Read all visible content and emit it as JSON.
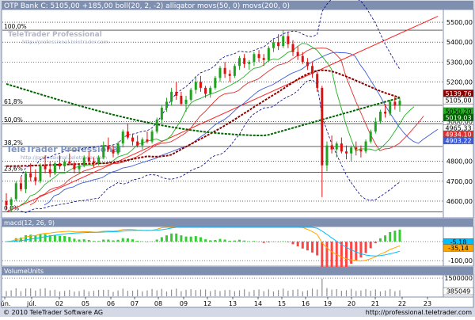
{
  "header": {
    "title": "OTP Bank C: 5105,00 +185,00 boll(20, 2, -2) alligator movs(50, 0) movs(200, 0)"
  },
  "watermark": {
    "brand": "TeleTrader Professional",
    "url": "http://professional.teletrader.com"
  },
  "footer": {
    "copyright": "© 2010 TeleTrader Software AG",
    "url": "http://professional.teletrader.com"
  },
  "colors": {
    "frame": "#7f8fb0",
    "axis_bg": "#ffffff",
    "grid": "#000000",
    "up": "#1fa31f",
    "down": "#e01010",
    "trendline": "#ff2020",
    "boll_band": "#00008b",
    "boll_mid": "#cc3333",
    "alligator_jaw": "#3b5bdb",
    "alligator_teeth": "#e03030",
    "alligator_lips": "#20b020",
    "ma50": "#8b0000",
    "ma200": "#006400",
    "macd_line": "#ffa500",
    "macd_signal": "#00bfff",
    "hist_pos": "#33cc33",
    "hist_neg": "#ff4444",
    "volume": "#909090"
  },
  "chart_data": [
    {
      "type": "candlestick",
      "ylim": [
        4520,
        5560
      ],
      "y_ticks": [
        "5500,00",
        "5400,00",
        "5300,00",
        "5200,00",
        "5000,00",
        "4800,00",
        "4700,00",
        "4600,00"
      ],
      "y_tick_values": [
        5500,
        5400,
        5300,
        5200,
        5000,
        4800,
        4700,
        4600
      ],
      "x_labels": [
        "jún.",
        "júl.",
        "02",
        "05",
        "06",
        "07",
        "08",
        "09",
        "12",
        "13",
        "14",
        "15",
        "16",
        "19",
        "20",
        "21",
        "22",
        "23"
      ],
      "fib_levels": [
        {
          "label": "100,0%",
          "value": 5460
        },
        {
          "label": "61,8%",
          "value": 5082
        },
        {
          "label": "50,0%",
          "value": 4990
        },
        {
          "label": "38,2%",
          "value": 4875
        },
        {
          "label": "23,6%",
          "value": 4745
        },
        {
          "label": "0,0%",
          "value": 4545
        }
      ],
      "price_tags": [
        {
          "label": "5139,76",
          "value": 5139.76,
          "bg": "#8b0000",
          "fg": "#ffffff"
        },
        {
          "label": "5105,00",
          "value": 5105,
          "bg": "#ffffff",
          "fg": "#000000"
        },
        {
          "label": "5050,20",
          "value": 5050.2,
          "bg": "#20b020",
          "fg": "#000000"
        },
        {
          "label": "5019,03",
          "value": 5019.03,
          "bg": "#006400",
          "fg": "#ffffff"
        },
        {
          "label": "4965,33",
          "value": 4965.33,
          "bg": "#ffffff",
          "fg": "#000000"
        },
        {
          "label": "4934,10",
          "value": 4934.1,
          "bg": "#e03030",
          "fg": "#ffffff"
        },
        {
          "label": "4903,22",
          "value": 4903.22,
          "bg": "#3b5bdb",
          "fg": "#ffffff"
        }
      ],
      "candles": [
        [
          4600,
          4640,
          4560,
          4580
        ],
        [
          4580,
          4620,
          4545,
          4610
        ],
        [
          4610,
          4700,
          4600,
          4690
        ],
        [
          4690,
          4720,
          4650,
          4660
        ],
        [
          4660,
          4750,
          4640,
          4740
        ],
        [
          4740,
          4790,
          4700,
          4720
        ],
        [
          4720,
          4760,
          4680,
          4700
        ],
        [
          4700,
          4790,
          4690,
          4780
        ],
        [
          4780,
          4830,
          4740,
          4760
        ],
        [
          4760,
          4800,
          4720,
          4740
        ],
        [
          4740,
          4800,
          4730,
          4790
        ],
        [
          4790,
          4830,
          4760,
          4775
        ],
        [
          4775,
          4810,
          4750,
          4800
        ],
        [
          4800,
          4840,
          4780,
          4790
        ],
        [
          4790,
          4800,
          4740,
          4760
        ],
        [
          4760,
          4790,
          4740,
          4780
        ],
        [
          4780,
          4830,
          4770,
          4820
        ],
        [
          4820,
          4850,
          4790,
          4800
        ],
        [
          4800,
          4820,
          4770,
          4790
        ],
        [
          4790,
          4830,
          4780,
          4820
        ],
        [
          4820,
          4900,
          4810,
          4880
        ],
        [
          4880,
          4920,
          4850,
          4860
        ],
        [
          4860,
          4880,
          4820,
          4840
        ],
        [
          4840,
          4900,
          4830,
          4890
        ],
        [
          4890,
          4960,
          4870,
          4950
        ],
        [
          4950,
          4990,
          4910,
          4920
        ],
        [
          4920,
          4940,
          4880,
          4900
        ],
        [
          4900,
          4930,
          4870,
          4880
        ],
        [
          4880,
          4920,
          4860,
          4910
        ],
        [
          4910,
          4950,
          4890,
          4900
        ],
        [
          4900,
          4960,
          4890,
          4950
        ],
        [
          4950,
          5020,
          4940,
          5010
        ],
        [
          5010,
          5080,
          4990,
          5070
        ],
        [
          5070,
          5120,
          5050,
          5100
        ],
        [
          5100,
          5170,
          5080,
          5150
        ],
        [
          5150,
          5200,
          5110,
          5130
        ],
        [
          5130,
          5150,
          5080,
          5090
        ],
        [
          5090,
          5130,
          5050,
          5110
        ],
        [
          5110,
          5170,
          5100,
          5160
        ],
        [
          5160,
          5230,
          5140,
          5200
        ],
        [
          5200,
          5230,
          5150,
          5170
        ],
        [
          5170,
          5180,
          5120,
          5140
        ],
        [
          5140,
          5180,
          5120,
          5170
        ],
        [
          5170,
          5230,
          5160,
          5220
        ],
        [
          5220,
          5280,
          5200,
          5270
        ],
        [
          5270,
          5300,
          5220,
          5240
        ],
        [
          5240,
          5260,
          5200,
          5230
        ],
        [
          5230,
          5290,
          5220,
          5280
        ],
        [
          5280,
          5330,
          5260,
          5320
        ],
        [
          5320,
          5340,
          5270,
          5290
        ],
        [
          5290,
          5310,
          5260,
          5300
        ],
        [
          5300,
          5350,
          5280,
          5340
        ],
        [
          5340,
          5360,
          5300,
          5320
        ],
        [
          5320,
          5340,
          5280,
          5310
        ],
        [
          5310,
          5380,
          5300,
          5370
        ],
        [
          5370,
          5420,
          5350,
          5400
        ],
        [
          5400,
          5440,
          5360,
          5380
        ],
        [
          5380,
          5460,
          5370,
          5430
        ],
        [
          5430,
          5450,
          5370,
          5390
        ],
        [
          5390,
          5410,
          5330,
          5350
        ],
        [
          5350,
          5380,
          5310,
          5330
        ],
        [
          5330,
          5350,
          5290,
          5300
        ],
        [
          5300,
          5320,
          5260,
          5280
        ],
        [
          5280,
          5300,
          5220,
          5240
        ],
        [
          5240,
          5250,
          5150,
          5170
        ],
        [
          5170,
          5180,
          4620,
          4780
        ],
        [
          4780,
          4900,
          4750,
          4880
        ],
        [
          4880,
          4930,
          4840,
          4860
        ],
        [
          4860,
          4900,
          4820,
          4890
        ],
        [
          4890,
          4920,
          4840,
          4850
        ],
        [
          4850,
          4880,
          4810,
          4840
        ],
        [
          4840,
          4880,
          4800,
          4870
        ],
        [
          4870,
          4900,
          4830,
          4860
        ],
        [
          4860,
          4880,
          4820,
          4850
        ],
        [
          4850,
          4910,
          4840,
          4900
        ],
        [
          4900,
          4960,
          4890,
          4950
        ],
        [
          4950,
          5020,
          4940,
          5000
        ],
        [
          5000,
          5060,
          4990,
          5050
        ],
        [
          5050,
          5090,
          5020,
          5040
        ],
        [
          5040,
          5110,
          5030,
          5100
        ],
        [
          5100,
          5130,
          5060,
          5080
        ],
        [
          5080,
          5120,
          5050,
          5105
        ]
      ]
    },
    {
      "type": "histogram",
      "title": "macd(12, 26, 9)",
      "ylim": [
        -125,
        75
      ],
      "y_ticks": [
        "0,00",
        "-100,00"
      ],
      "y_tick_values": [
        0,
        -100
      ],
      "value_tags": [
        {
          "label": "-5,18",
          "value": -5.18,
          "bg": "#00bfff"
        },
        {
          "label": "-35,14",
          "value": -35.14,
          "bg": "#ffa500"
        }
      ]
    },
    {
      "type": "bar",
      "title": "VolumeUnits",
      "ylim": [
        0,
        1700000
      ],
      "y_ticks": [
        "1500000"
      ],
      "y_tick_values": [
        1500000
      ],
      "value_tags": [
        {
          "label": "385049",
          "value": 385049,
          "bg": "#ffffff"
        }
      ]
    }
  ]
}
